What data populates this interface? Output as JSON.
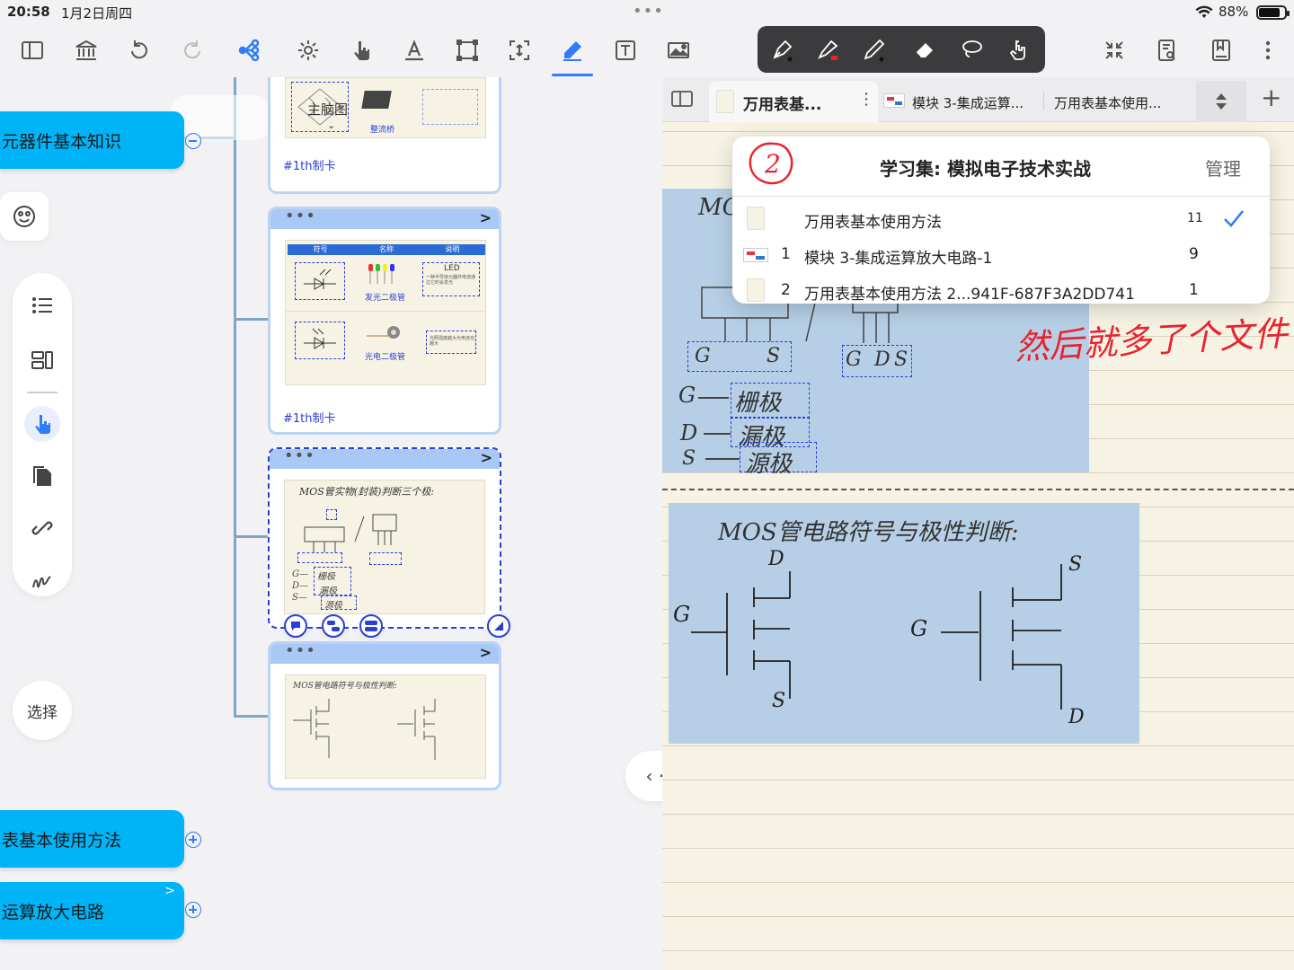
{
  "status_bar": {
    "time": "20:58",
    "date": "1月2日周四",
    "more_dots": "•••",
    "battery_percent": "88%",
    "battery_level": 0.88
  },
  "toolbar": {
    "left_icons": [
      "sidebar-icon",
      "library-icon",
      "undo-icon",
      "redo-icon",
      "mindmap-icon",
      "gear-cycle-icon",
      "pointer-hand-icon",
      "text-format-icon",
      "frame-icon",
      "expand-frame-icon",
      "pencil-icon",
      "textbox-icon",
      "image-icon"
    ],
    "active": "pencil-icon",
    "right_icons": [
      "collapse-icon",
      "search-document-icon",
      "bookmark-icon",
      "more-vertical-icon"
    ]
  },
  "pen_tools": [
    "fountain-pen-icon",
    "highlighter-icon",
    "pencil-tool-icon",
    "eraser-icon",
    "lasso-icon",
    "touch-hand-icon"
  ],
  "mindmap": {
    "nodes": [
      {
        "label": "元器件基本知识"
      },
      {
        "label": "表基本使用方法"
      },
      {
        "label": "运算放大电路",
        "chevron": ">"
      }
    ],
    "cards": [
      {
        "tag": "#1th制卡",
        "inner_label": "主脑图",
        "sub_label": "整流桥"
      },
      {
        "tag": "#1th制卡",
        "table_headers": [
          "符号",
          "名称",
          "说明"
        ],
        "rows": [
          {
            "name": "发光二极管",
            "desc_title": "LED",
            "desc": "一种半导体元器件电流通过它时会发光"
          },
          {
            "name": "光电二极管",
            "desc": "光照强度越大光电流也越大"
          }
        ]
      },
      {
        "tag": "",
        "handwriting": "MOS管实物(封装)判断三个极:",
        "labels": [
          "G",
          "S",
          "G",
          "D",
          "S",
          "G",
          "D",
          "S",
          "栅极",
          "漏极",
          "源极"
        ]
      },
      {
        "tag": "",
        "handwriting": "MOS管电路符号与极性判断:"
      }
    ],
    "card_head_dots": "•••",
    "card_head_chevron": ">",
    "select_button": "选择",
    "side_tools": [
      "list-icon",
      "layout-icon",
      "pointer-icon",
      "documents-icon",
      "link-icon",
      "scribble-icon"
    ]
  },
  "notes": {
    "tabs": [
      {
        "label": "万用表基..."
      },
      {
        "label": "模块 3-集成运算..."
      },
      {
        "label": "万用表基本使用..."
      }
    ],
    "tab_more": "⋮",
    "tab_add": "+",
    "dropdown": {
      "badge": "2",
      "title": "学习集: 模拟电子技术实战",
      "manage": "管理",
      "items": [
        {
          "index": "",
          "label": "万用表基本使用方法",
          "count": "11",
          "checked": true
        },
        {
          "index": "1",
          "label": "模块 3-集成运算放大电路-1",
          "count": "9",
          "checked": false
        },
        {
          "index": "2",
          "label": "万用表基本使用方法 2...941F-687F3A2DD741",
          "count": "1",
          "checked": false
        }
      ]
    },
    "handwriting_red": "然后就多了个文件",
    "section1": {
      "title_partial": "MOS",
      "pins_left": [
        "G",
        "S"
      ],
      "pins_right": [
        "G",
        "D",
        "S"
      ],
      "legend": [
        {
          "pin": "G",
          "name": "栅极"
        },
        {
          "pin": "D",
          "name": "漏极"
        },
        {
          "pin": "S",
          "name": "源极"
        }
      ]
    },
    "section2": {
      "title": "MOS管电路符号与极性判断:",
      "left_symbol": {
        "gate": "G",
        "top": "D",
        "bottom": "S"
      },
      "right_symbol": {
        "gate": "G",
        "top": "S",
        "bottom": "D"
      }
    },
    "nav_handle": "‹ · ›"
  },
  "colors": {
    "accent": "#2f7cf6",
    "node_blue": "#00b4f7",
    "card_border": "#bcd3f2",
    "selection_blue": "#2a3fd4",
    "note_paper": "#f7f3e4",
    "note_highlight": "#b6cfe6",
    "ink_red": "#e8232f"
  }
}
